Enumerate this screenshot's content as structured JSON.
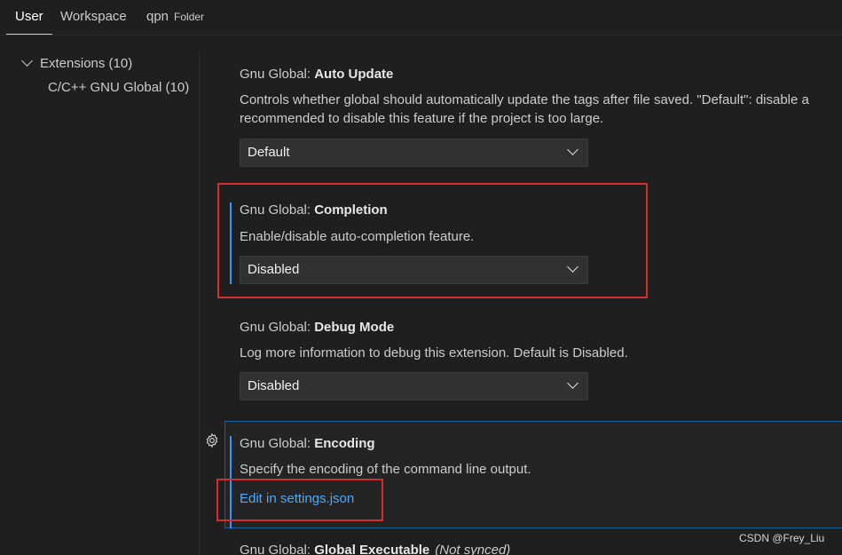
{
  "tabs": [
    {
      "label": "User",
      "active": true
    },
    {
      "label": "Workspace",
      "active": false
    },
    {
      "label": "qpn",
      "sublabel": "Folder",
      "active": false
    }
  ],
  "toc": {
    "group": {
      "label": "Extensions (10)",
      "expanded": true
    },
    "child": {
      "label": "C/C++ GNU Global (10)"
    }
  },
  "settings": [
    {
      "category": "Gnu Global: ",
      "key": "Auto Update",
      "description_lines": [
        "Controls whether global should automatically update the tags after file saved. \"Default\": disable a",
        "recommended to disable this feature if the project is too large."
      ],
      "value": "Default"
    },
    {
      "category": "Gnu Global: ",
      "key": "Completion",
      "description": "Enable/disable auto-completion feature.",
      "value": "Disabled",
      "modified": true
    },
    {
      "category": "Gnu Global: ",
      "key": "Debug Mode",
      "description": "Log more information to debug this extension. Default is Disabled.",
      "value": "Disabled"
    },
    {
      "category": "Gnu Global: ",
      "key": "Encoding",
      "description": "Specify the encoding of the command line output.",
      "link": "Edit in settings.json",
      "modified": true
    },
    {
      "category": "Gnu Global: ",
      "key": "Global Executable",
      "tag": "(Not synced)"
    }
  ],
  "icons": {
    "gear": "gear-icon",
    "chevron": "chevron-down-icon"
  },
  "colors": {
    "accent": "#3794ff",
    "link": "#4daafc",
    "annotation": "#d32f2f"
  },
  "watermark": "CSDN @Frey_Liu"
}
